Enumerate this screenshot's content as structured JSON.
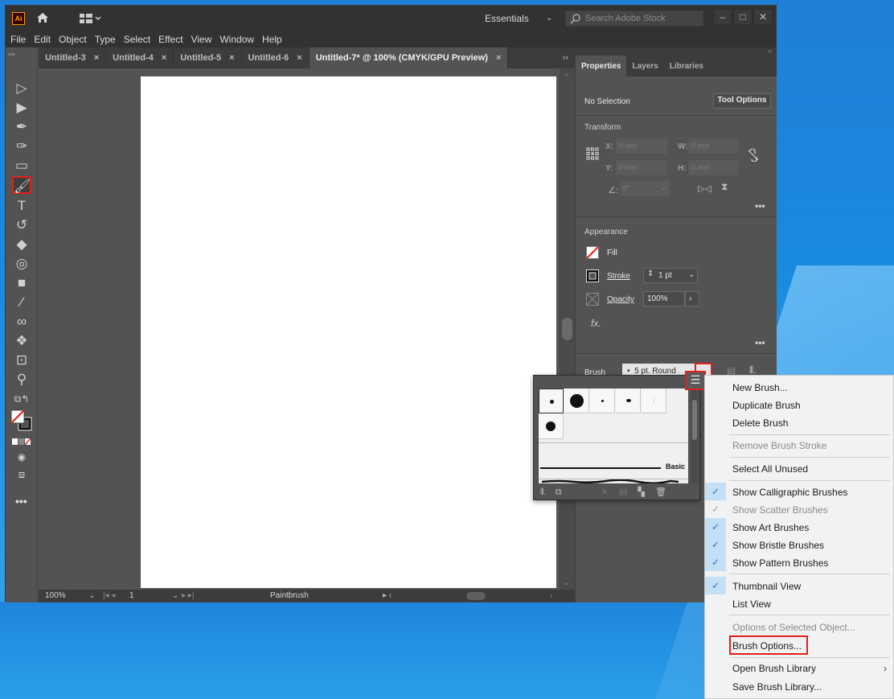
{
  "app": {
    "logo": "Ai",
    "workspace": "Essentials",
    "stock_search_placeholder": "Search Adobe Stock",
    "menu": [
      "File",
      "Edit",
      "Object",
      "Type",
      "Select",
      "Effect",
      "View",
      "Window",
      "Help"
    ]
  },
  "tabs": [
    {
      "label": "Untitled-3",
      "close": "×",
      "active": false
    },
    {
      "label": "Untitled-4",
      "close": "×",
      "active": false
    },
    {
      "label": "Untitled-5",
      "close": "×",
      "active": false
    },
    {
      "label": "Untitled-6",
      "close": "×",
      "active": false
    },
    {
      "label": "Untitled-7* @ 100% (CMYK/GPU Preview)",
      "close": "×",
      "active": true
    }
  ],
  "tabs_more": "››",
  "status": {
    "zoom": "100%",
    "artboard_num": "1",
    "tool_name": "Paintbrush"
  },
  "panel": {
    "tabs": [
      "Properties",
      "Layers",
      "Libraries"
    ],
    "no_selection": "No Selection",
    "tool_options": "Tool Options",
    "transform_title": "Transform",
    "x_label": "X:",
    "y_label": "Y:",
    "w_label": "W:",
    "h_label": "H:",
    "x_val": "0 mm",
    "y_val": "0 mm",
    "w_val": "0 mm",
    "h_val": "0 mm",
    "angle_val": "0°",
    "appearance_title": "Appearance",
    "fill": "Fill",
    "stroke": "Stroke",
    "stroke_val": "1 pt",
    "opacity": "Opacity",
    "opacity_val": "100%",
    "fx": "fx.",
    "brush_label": "Brush",
    "brush_val": "5 pt. Round",
    "more": "•••"
  },
  "brush_popover": {
    "basic_label": "Basic"
  },
  "context_menu": {
    "items": [
      {
        "label": "New Brush...",
        "disabled": false,
        "checked": null
      },
      {
        "label": "Duplicate Brush",
        "disabled": false,
        "checked": null
      },
      {
        "label": "Delete Brush",
        "disabled": false,
        "checked": null
      },
      {
        "label": "Remove Brush Stroke",
        "disabled": true,
        "checked": null
      },
      {
        "label": "Select All Unused",
        "disabled": false,
        "checked": null
      },
      {
        "label": "Show Calligraphic Brushes",
        "disabled": false,
        "checked": true
      },
      {
        "label": "Show Scatter Brushes",
        "disabled": true,
        "checked": true
      },
      {
        "label": "Show Art Brushes",
        "disabled": false,
        "checked": true
      },
      {
        "label": "Show Bristle Brushes",
        "disabled": false,
        "checked": true
      },
      {
        "label": "Show Pattern Brushes",
        "disabled": false,
        "checked": true
      },
      {
        "label": "Thumbnail View",
        "disabled": false,
        "checked": true
      },
      {
        "label": "List View",
        "disabled": false,
        "checked": null
      },
      {
        "label": "Options of Selected Object...",
        "disabled": true,
        "checked": null
      },
      {
        "label": "Brush Options...",
        "disabled": false,
        "checked": null
      },
      {
        "label": "Open Brush Library",
        "disabled": false,
        "checked": null
      },
      {
        "label": "Save Brush Library...",
        "disabled": false,
        "checked": null
      }
    ],
    "submenu_arrow": "›"
  },
  "colors": {
    "highlight": "#e0201a",
    "ui_dark": "#323232",
    "ui_mid": "#535353",
    "check_bg": "#c3dff6"
  }
}
